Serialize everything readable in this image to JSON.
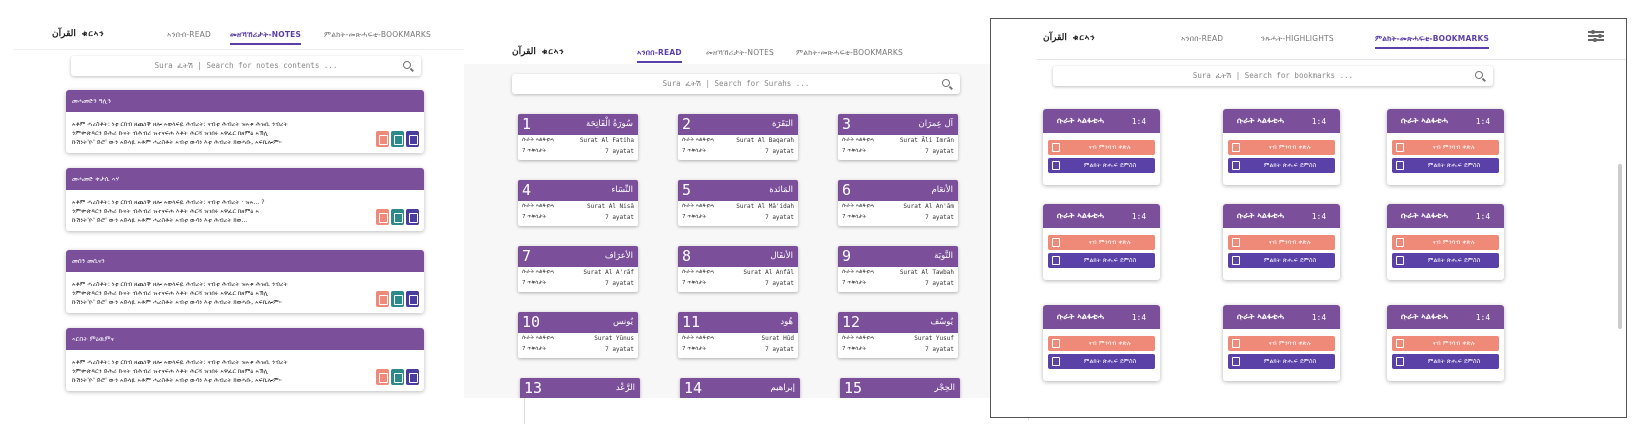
{
  "brand": {
    "arabic": "القرآن",
    "ethiopic": "ቁርኣን"
  },
  "notes_panel": {
    "tabs": [
      {
        "label": "ኣንበብ-READ",
        "active": false
      },
      {
        "label": " መዘኻኸሪታት-NOTES",
        "active": true
      },
      {
        "label": "ምልክት-መጽሓፍቲ-BOOKMARKS",
        "active": false
      }
    ],
    "search_placeholder": "Sura ፈትሽ | Search for notes contents ...",
    "notes": [
      {
        "title": "መሓመድን ዓሊን",
        "lines": [
          "ኣቶም ሓረስቶት: ነቲ ርክብ ዘጨነቕ ዘሎ ኣወላፍዪ ሕብረት: ናብቲ ሕብረት ዝኣቱ ሕዝቢ ንብረት",
          "ንምቍጽጻርን ድሕሪ ኩናት ብሕብሪ ዝተናፍሐ እቶት ሕርሻ ዝገበሩ ኣዋፈር ክዘምዕ ኣኽሊ",
          "ኩሽነት'ዮ' ድሮ' ውን ኣድላዪ ኣቶም ሓረስቶት ኣብቲ ውሳነ እቲ ሕብረት ክወሓቡ, ኣፍኪሎም።"
        ]
      },
      {
        "title": "መሓመድ ቀታሲ ኣሃ",
        "lines": [
          "ኣቶም ሓረስቶት: ነቲ ርክብ ዘጨነቕ ዘሎ ኣወላፍዪ ሕብረት: ናብቲ ሕብረት · ዝኣ... ?",
          "ንምቍጽጻርን ድሕሪ ኩናት ብሕብሪ ዝተናፍሐ እቶት ሕርሻ ዝገበሩ ኣዋፈር ክዘምዕ ኣ",
          "ኩሽነት'ዮ' ድሮ' ውን ኣድላዪ ኣቶም ሓረስቶት ኣብቲ ውሳነ እቲ ሕብረት ክወ..."
        ]
      },
      {
        "title": "መሰን መሲናን",
        "lines": [
          "ኣቶም ሓረስቶት: ነቲ ርክብ ዘጨነቕ ዘሎ ኣወላፍዪ ሕብረት: ናብቲ ሕብረት ዝኣቱ ሕዝቢ ንብረት",
          "ንምቍጽጻርን ድሕሪ ኩናት ብሕብሪ ዝተናፍሐ እቶት ሕርሻ ዝገበሩ ኣዋፈር ክዘምዕ ኣኽሊ",
          "ኩሽነት'ዮ' ድሮ' ውን ኣድላዪ ኣቶም ሓረስቶት ኣብቲ ውሳነ እቲ ሕብረት ክወሓቡ, ኣፍኪሎም።"
        ]
      },
      {
        "title": "ኣርበት ምዕዉምና",
        "lines": [
          "ኣቶም ሓረስቶት: ነቲ ርክብ ዘጨነቕ ዘሎ ኣወላፍዪ ሕብረት: ናብቲ ሕብረት ዝኣቱ ሕዝቢ ንብረት",
          "ንምቍጽጻርን ድሕሪ ኩናት ብሕብሪ ዝተናፍሐ እቶት ሕርሻ ዝገበሩ ኣዋፈር ክዘምዕ ኣኽሊ",
          "ኩሽነት'ዮ' ድሮ' ውን ኣድላዪ ኣቶም ሓረስቶት ኣብቲ ውሳነ እቲ ሕብረት ክወሓቡ, ኣፍኪሎም።"
        ]
      }
    ]
  },
  "read_panel": {
    "tabs": [
      {
        "label": "ኣንበበ-READ",
        "active": true
      },
      {
        "label": "መዘኻኸሪታት-NOTES",
        "active": false
      },
      {
        "label": "ምልክት-መጽሓፍቲ-BOOKMARKS",
        "active": false
      }
    ],
    "search_placeholder": "Sura ፈትሽ | Search for Surahs ...",
    "surah_label": "ሱራት ኣልፋቲሓ",
    "ayat_label": "7 ጥቅሳታት",
    "ayat_count": "7 ayatat",
    "surahs": [
      {
        "num": "1",
        "arabic": "سُورَةُ الْفَاتِحَة",
        "name": "Surat Al Fatiha"
      },
      {
        "num": "2",
        "arabic": "البَقَرَة",
        "name": "Surat Al Baqarah"
      },
      {
        "num": "3",
        "arabic": "آل عِمرَان",
        "name": "Surat Āli Imrān"
      },
      {
        "num": "4",
        "arabic": "النِّسَاء",
        "name": "Surat Al Nisā"
      },
      {
        "num": "5",
        "arabic": "المَائدة",
        "name": "Surat Al Mā'idah"
      },
      {
        "num": "6",
        "arabic": "الأنعَام",
        "name": "Surat Al An'ām"
      },
      {
        "num": "7",
        "arabic": "الأعرَاف",
        "name": "Surat Al A'rāf"
      },
      {
        "num": "8",
        "arabic": "الأنفَال",
        "name": "Surat Al Anfāl"
      },
      {
        "num": "9",
        "arabic": "التَّوبَة",
        "name": "Surat Al Tawbah"
      },
      {
        "num": "10",
        "arabic": "يُونس",
        "name": "Surat Yūnus"
      },
      {
        "num": "11",
        "arabic": "هُود",
        "name": "Surat Hūd"
      },
      {
        "num": "12",
        "arabic": "يُوسُف",
        "name": "Surat Yusuf"
      },
      {
        "num": "13",
        "arabic": "الرَّعْد",
        "name": ""
      },
      {
        "num": "14",
        "arabic": "إبراهيم",
        "name": ""
      },
      {
        "num": "15",
        "arabic": "الحِجْر",
        "name": ""
      }
    ]
  },
  "bookmarks_panel": {
    "tabs": [
      {
        "label": "ኣንበበ-READ",
        "active": false
      },
      {
        "label": "ንጹሓት-HIGHLIGHTS",
        "active": false
      },
      {
        "label": "ምልክት-መጽሓፍቲ-BOOKMARKS",
        "active": true
      }
    ],
    "search_placeholder": "Sura ፈትሽ | Search for bookmarks  ...",
    "bookmark": {
      "title": "ሱራት ኣልፋቲሓ",
      "ref": "1:4",
      "remove_label": "ናብ ምንባብ ቀጽሉ",
      "goto_label": "ምልክት ጽሑፍ ደምስስ"
    },
    "count": 9
  }
}
